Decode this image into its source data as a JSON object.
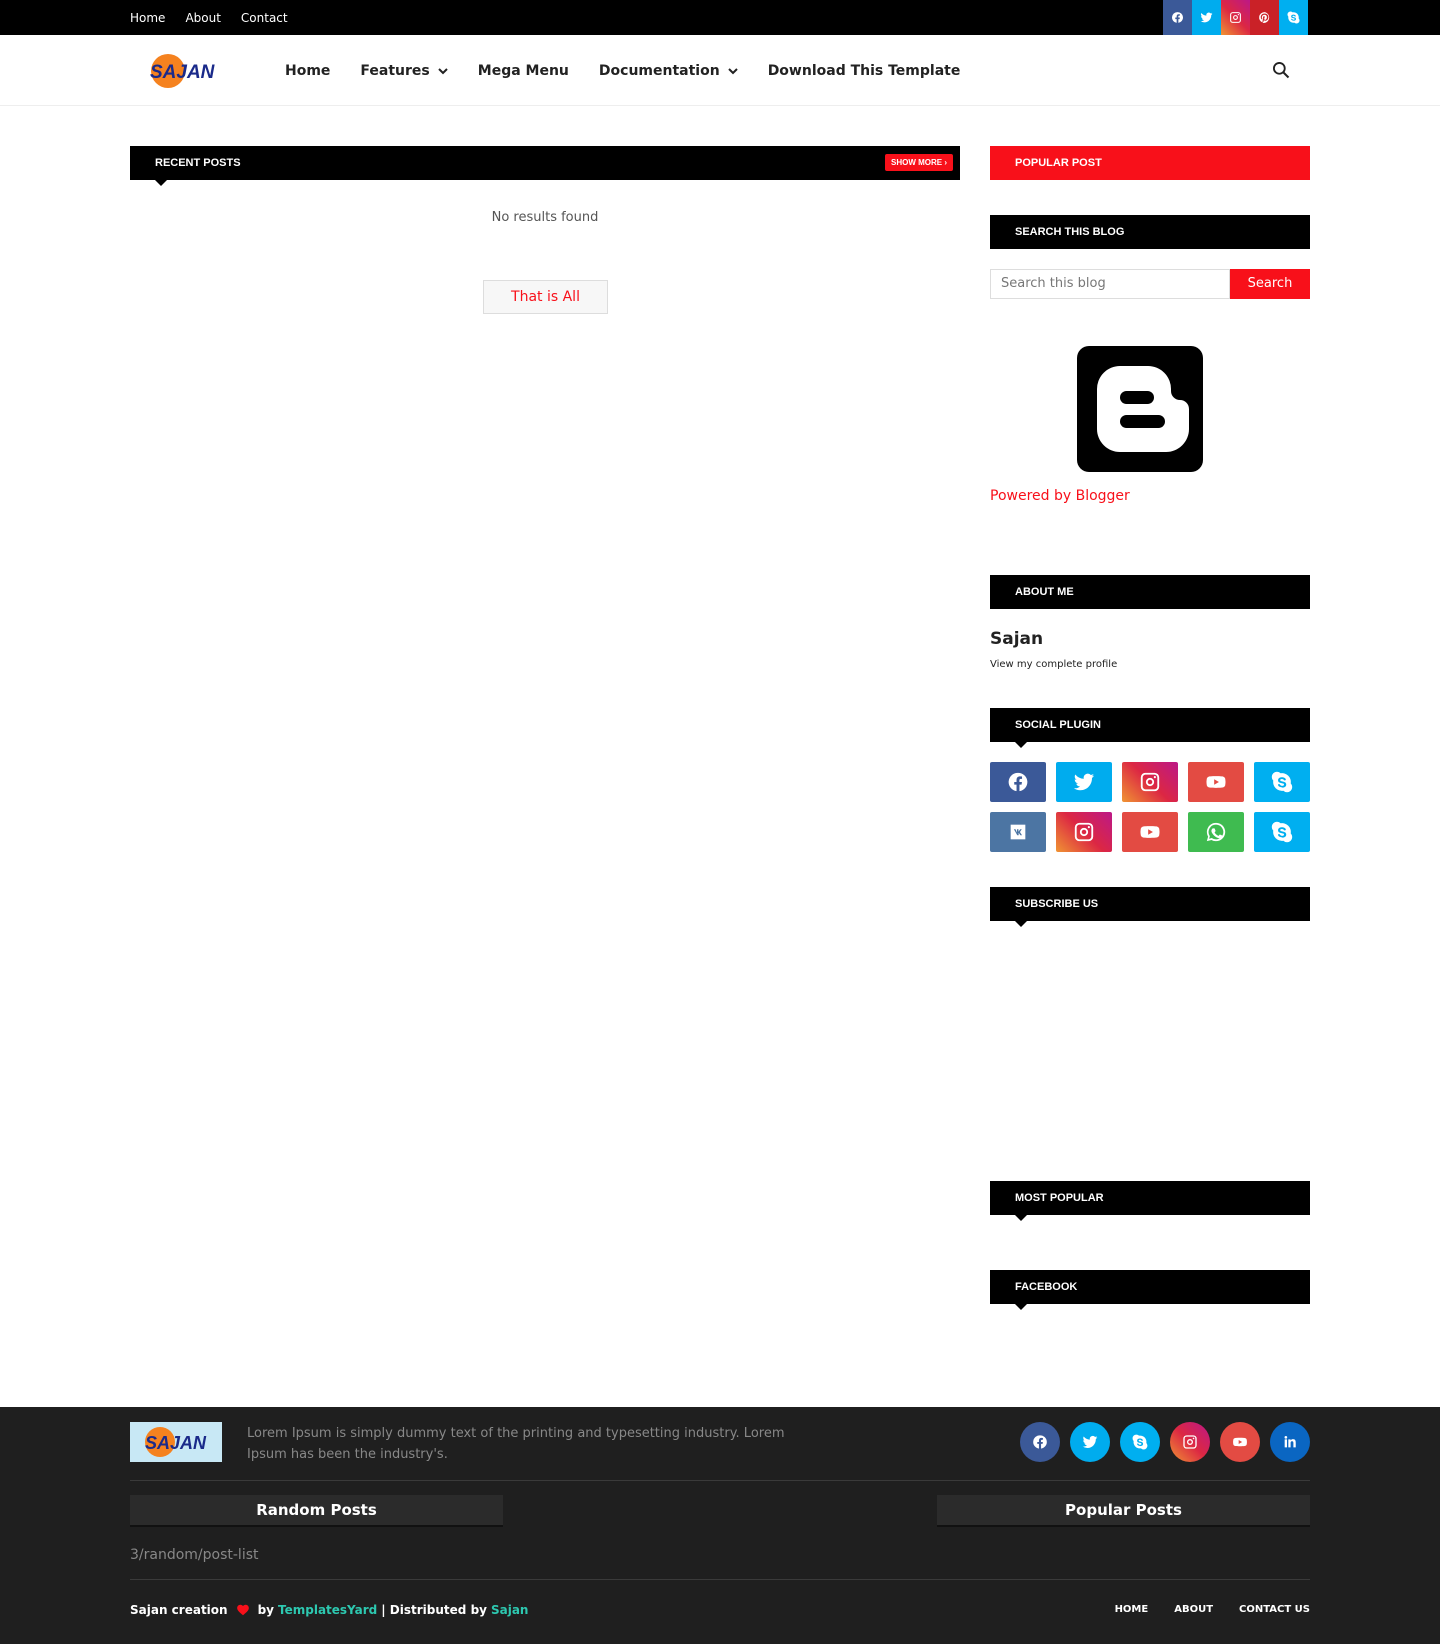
{
  "topbar": {
    "menu": [
      "Home",
      "About",
      "Contact"
    ],
    "social": [
      "facebook-icon",
      "twitter-icon",
      "instagram-icon",
      "pinterest-icon",
      "skype-icon"
    ]
  },
  "header": {
    "logo_text": "SAJAN",
    "nav": [
      {
        "label": "Home",
        "dropdown": false
      },
      {
        "label": "Features",
        "dropdown": true
      },
      {
        "label": "Mega Menu",
        "dropdown": false
      },
      {
        "label": "Documentation",
        "dropdown": true
      },
      {
        "label": "Download This Template",
        "dropdown": false
      }
    ]
  },
  "main": {
    "recent_title": "Recent Posts",
    "show_more": "SHOW MORE",
    "no_results": "No results found",
    "that_is_all": "That is All"
  },
  "sidebar": {
    "popular_post": "Popular Post",
    "search_title": "Search This Blog",
    "search_placeholder": "Search this blog",
    "search_button": "Search",
    "powered": "Powered by Blogger",
    "about_title": "About Me",
    "about_name": "Sajan",
    "about_link": "View my complete profile",
    "social_title": "Social Plugin",
    "subscribe_title": "Subscribe Us",
    "most_popular_title": "Most Popular",
    "facebook_title": "Facebook"
  },
  "footer": {
    "description": "Lorem Ipsum is simply dummy text of the printing and typesetting industry. Lorem Ipsum has been the industry's.",
    "random_posts": "Random Posts",
    "popular_posts": "Popular Posts",
    "random_placeholder": "3/random/post-list",
    "credit_1": "Sajan creation",
    "credit_by": "by",
    "credit_link1": "TemplatesYard",
    "credit_mid": "| Distributed by",
    "credit_link2": "Sajan",
    "menu": [
      "HOME",
      "ABOUT",
      "CONTACT US"
    ]
  },
  "colors": {
    "accent": "#f8101a",
    "topbar": "#000000",
    "footer": "#1f1f1f",
    "footer_link": "#2dc8b0"
  }
}
